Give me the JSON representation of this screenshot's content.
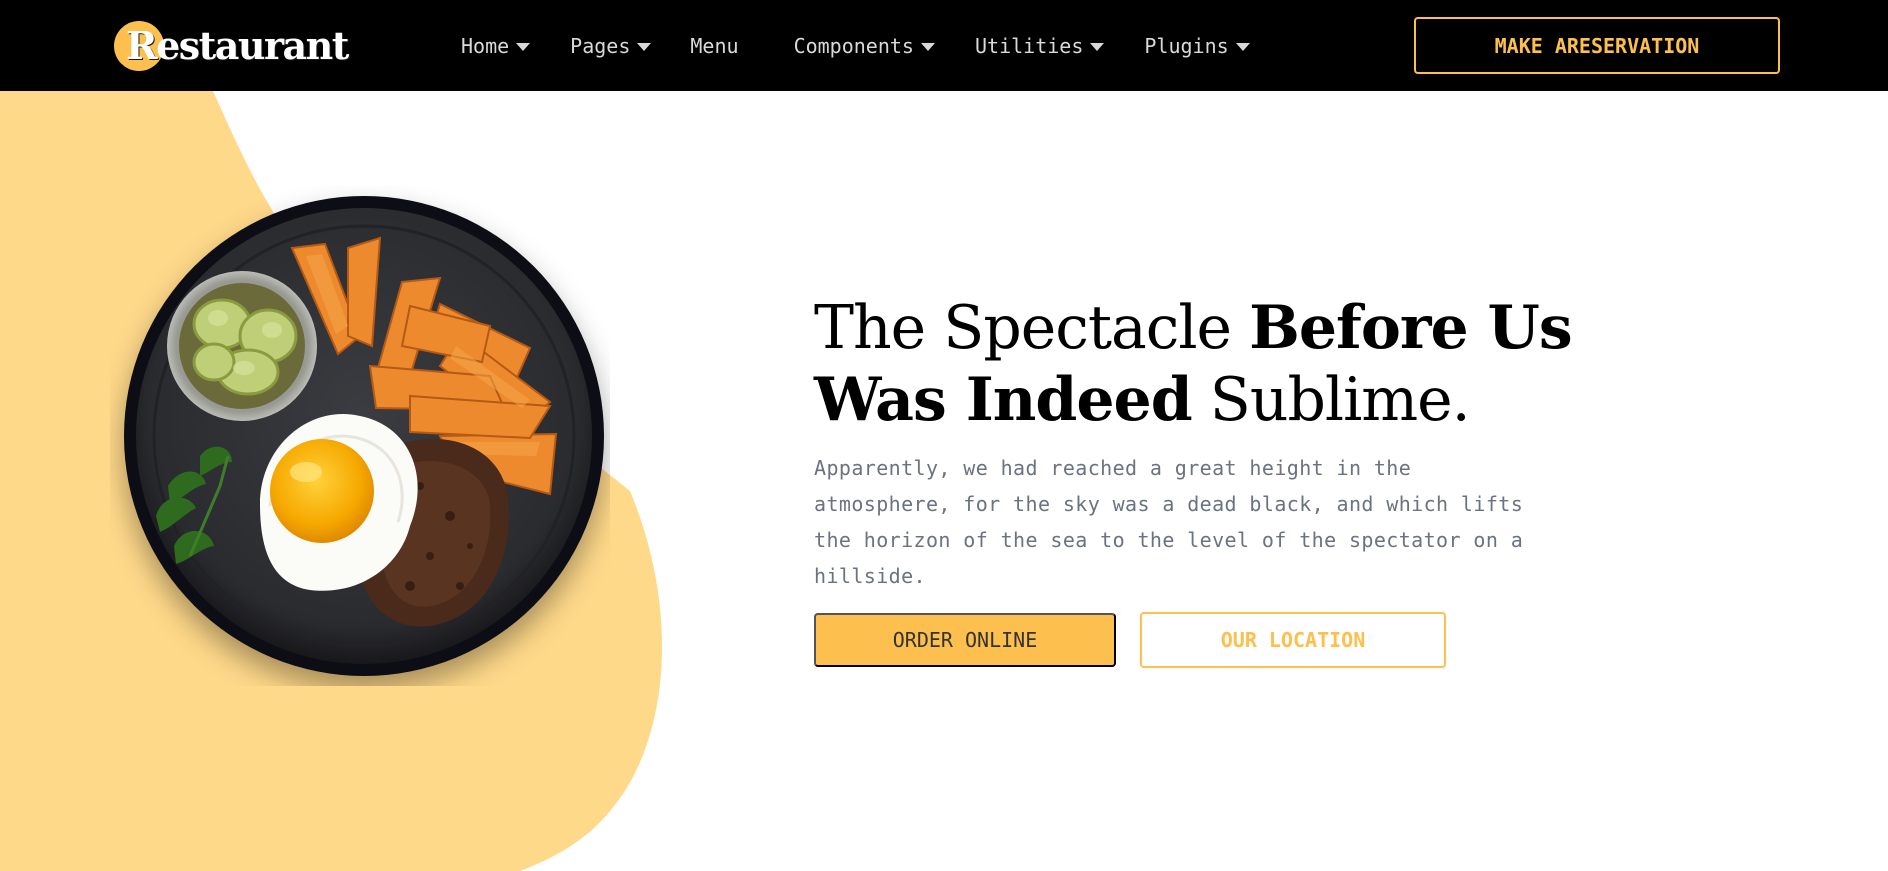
{
  "brand": {
    "logo_text": "Restaurant",
    "accent_color": "#fdc04e",
    "blob_color": "#ffd98a"
  },
  "nav": {
    "items": [
      {
        "label": "Home",
        "dropdown": true
      },
      {
        "label": "Pages",
        "dropdown": true
      },
      {
        "label": "Menu",
        "dropdown": false
      },
      {
        "label": "Components",
        "dropdown": true
      },
      {
        "label": "Utilities",
        "dropdown": true
      },
      {
        "label": "Plugins",
        "dropdown": true
      }
    ],
    "reserve_label": "MAKE ARESERVATION"
  },
  "hero": {
    "headline_light_1": "The Spectacle ",
    "headline_bold_1": "Before Us",
    "headline_bold_2": "Was Indeed",
    "headline_light_2": " Sublime.",
    "lead": "Apparently, we had reached a great height in the atmosphere, for the sky was a dead black, and which lifts the horizon of the sea to the level of the spectator on a hillside.",
    "order_label": "ORDER ONLINE",
    "location_label": "OUR LOCATION"
  },
  "icons": {
    "dropdown": "caret-down-icon",
    "hero_image": "plate-of-food"
  }
}
